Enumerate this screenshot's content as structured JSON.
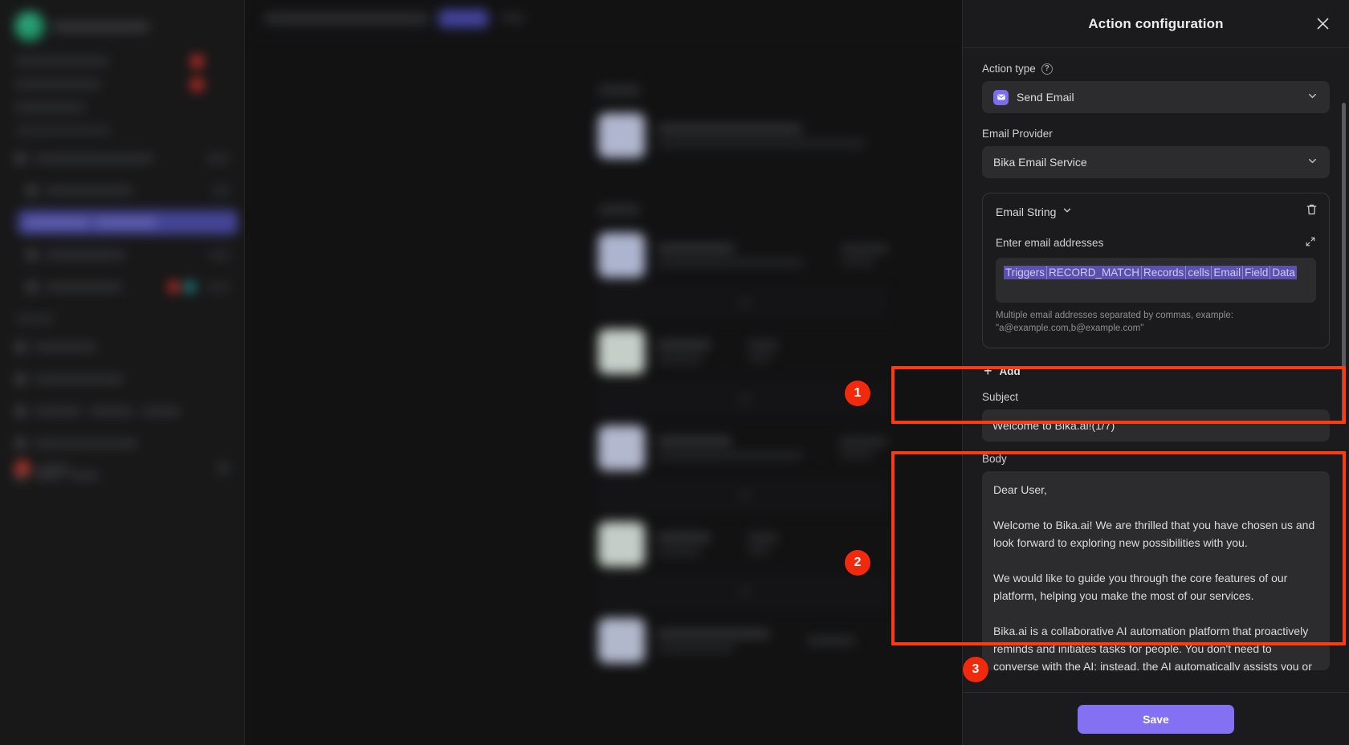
{
  "panel": {
    "title": "Action configuration",
    "close_icon": "close-icon",
    "action_type": {
      "label": "Action type",
      "help_icon": "help-circle-icon",
      "value": "Send Email",
      "icon": "email-icon",
      "chevron": "chevron-down-icon"
    },
    "email_provider": {
      "label": "Email Provider",
      "value": "Bika Email Service",
      "chevron": "chevron-down-icon"
    },
    "email_string": {
      "header": "Email String",
      "header_chevron": "chevron-down-icon",
      "delete_icon": "trash-icon",
      "field_label": "Enter email addresses",
      "expand_icon": "expand-icon",
      "tokens": [
        "Triggers",
        "RECORD_MATCH",
        "Records",
        "cells",
        "Email",
        "Field",
        "Data"
      ],
      "hint": "Multiple email addresses separated by commas, example: \"a@example.com,b@example.com\""
    },
    "add_button": {
      "label": "Add",
      "icon": "plus-icon"
    },
    "subject": {
      "label": "Subject",
      "value": "Welcome to Bika.ai!(1/7)"
    },
    "body": {
      "label": "Body",
      "paragraphs": [
        "Dear User,",
        "Welcome to Bika.ai! We are thrilled that you have chosen us and look forward to exploring new possibilities with you.",
        "We would like to guide you through the core features of our platform, helping you make the most of our services.",
        "Bika.ai is a collaborative AI automation platform that proactively reminds and initiates tasks for people. You don't need to converse with the AI; instead, the AI automatically assists you or"
      ]
    },
    "save_button": "Save"
  },
  "annotations": {
    "marker_color": "#f22a0d",
    "items": [
      {
        "number": "1",
        "target": "subject-field"
      },
      {
        "number": "2",
        "target": "body-field"
      },
      {
        "number": "3",
        "target": "save-button"
      }
    ]
  },
  "colors": {
    "accent": "#8370f2",
    "token": "#5a51ad",
    "panel_bg": "#1b1b1d",
    "input_bg": "#2c2c2f",
    "annotation_red": "#f22a0d"
  }
}
